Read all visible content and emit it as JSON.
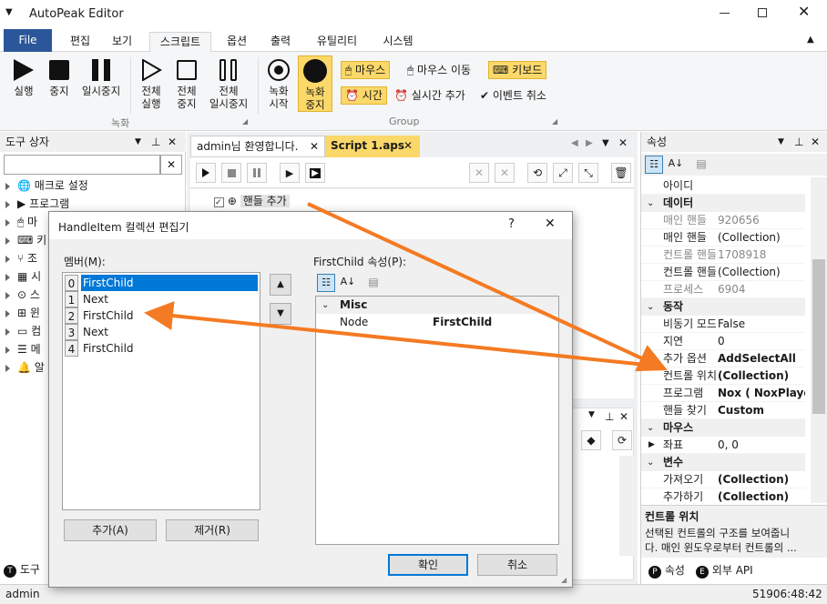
{
  "app": {
    "title": "AutoPeak Editor"
  },
  "menu": {
    "file": "File",
    "tabs": [
      "편집",
      "보기",
      "스크립트",
      "옵션",
      "출력",
      "유틸리티",
      "시스템"
    ]
  },
  "ribbon": {
    "run": "실행",
    "stop": "중지",
    "pause": "일시중지",
    "run_all_1": "전체",
    "run_all_2": "실행",
    "stop_all_1": "전체",
    "stop_all_2": "중지",
    "pause_all_1": "전체",
    "pause_all_2": "일시중지",
    "rec_start_1": "녹화",
    "rec_start_2": "시작",
    "rec_stop_1": "녹화",
    "rec_stop_2": "중지",
    "group_record": "녹화",
    "group_group": "Group",
    "mouse": "마우스",
    "mouse_move": "마우스 이동",
    "keyboard": "키보드",
    "time": "시간",
    "realtime_add": "실시간 추가",
    "event_cancel": "이벤트 취소"
  },
  "toolbox": {
    "header": "도구 상자",
    "items": [
      "매크로 설정",
      "프로그램",
      "마",
      "키",
      "조",
      "시",
      "스",
      "윈",
      "컴",
      "메",
      "알"
    ],
    "bottom_tab": "도구"
  },
  "editor": {
    "tab1": "admin님 환영합니다.",
    "tab2": "Script 1.aps",
    "node_label": "핸들 추가"
  },
  "properties": {
    "header": "속성",
    "rows": [
      {
        "type": "row",
        "k": "아이디",
        "v": "",
        "dis": false
      },
      {
        "type": "cat",
        "t": "데이터"
      },
      {
        "type": "row",
        "k": "매인 핸들",
        "v": "920656",
        "dis": true
      },
      {
        "type": "row",
        "k": "매인 핸들",
        "v": "(Collection)",
        "dis": false
      },
      {
        "type": "row",
        "k": "컨트롤 핸들",
        "v": "1708918",
        "dis": true
      },
      {
        "type": "row",
        "k": "컨트롤 핸들",
        "v": "(Collection)",
        "dis": false
      },
      {
        "type": "row",
        "k": "프로세스",
        "v": "6904",
        "dis": true
      },
      {
        "type": "cat",
        "t": "동작"
      },
      {
        "type": "row",
        "k": "비동기 모드",
        "v": "False",
        "dis": false
      },
      {
        "type": "row",
        "k": "지연",
        "v": "0",
        "dis": false
      },
      {
        "type": "row",
        "k": "추가 옵션",
        "v": "AddSelectAll",
        "dis": false,
        "bold": true
      },
      {
        "type": "row",
        "k": "컨트롤 위치",
        "v": "(Collection)",
        "dis": false,
        "bold": true
      },
      {
        "type": "row",
        "k": "프로그램",
        "v": "Nox ( NoxPlayer",
        "dis": false,
        "bold": true
      },
      {
        "type": "row",
        "k": "핸들 찾기",
        "v": "Custom",
        "dis": false,
        "bold": true
      },
      {
        "type": "cat",
        "t": "마우스"
      },
      {
        "type": "row",
        "k": "좌표",
        "v": "0, 0",
        "dis": false,
        "expand": true
      },
      {
        "type": "cat",
        "t": "변수"
      },
      {
        "type": "row",
        "k": "가져오기",
        "v": "(Collection)",
        "dis": false,
        "bold": true
      },
      {
        "type": "row",
        "k": "추가하기",
        "v": "(Collection)",
        "dis": false,
        "bold": true
      }
    ],
    "desc_title": "컨트롤 위치",
    "desc_line1": "선택된 컨트롤의 구조를 보여줍니",
    "desc_line2": "다. 매인 윈도우로부터 컨트롤의 ...",
    "tab_props": "속성",
    "tab_api": "외부 API"
  },
  "dialog": {
    "title": "HandleItem 컬렉션 편집기",
    "help": "?",
    "members_label": "멤버(M):",
    "members": [
      {
        "idx": "0",
        "name": "FirstChild"
      },
      {
        "idx": "1",
        "name": "Next"
      },
      {
        "idx": "2",
        "name": "FirstChild"
      },
      {
        "idx": "3",
        "name": "Next"
      },
      {
        "idx": "4",
        "name": "FirstChild"
      }
    ],
    "props_label": "FirstChild 속성(P):",
    "misc": "Misc",
    "node_key": "Node",
    "node_value": "FirstChild",
    "add": "추가(A)",
    "remove": "제거(R)",
    "ok": "확인",
    "cancel": "취소"
  },
  "status": {
    "left": "admin",
    "right": "51906:48:42"
  },
  "colors": {
    "accent": "#2b579a",
    "arrow": "#f47a23",
    "highlight": "#fbd86a",
    "selection": "#0078d7"
  }
}
